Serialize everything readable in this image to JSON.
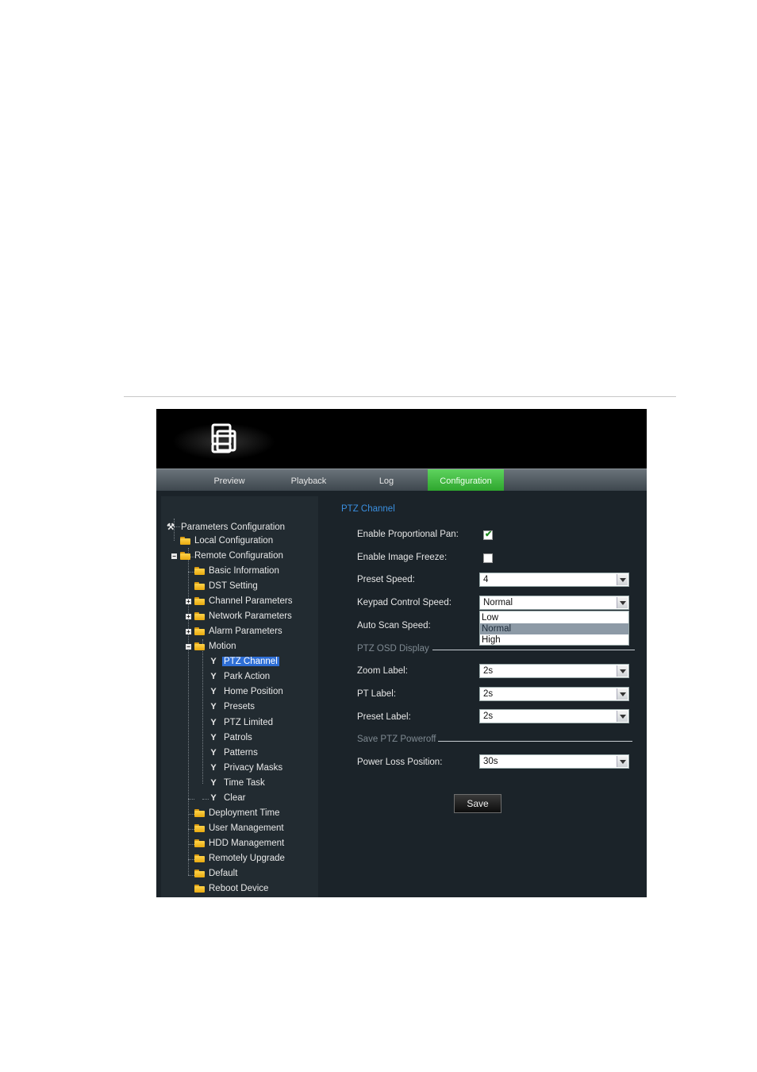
{
  "nav": {
    "tabs": [
      "Preview",
      "Playback",
      "Log",
      "Configuration"
    ],
    "active": "Configuration"
  },
  "tree": {
    "root": "Parameters Configuration",
    "items": [
      "Local Configuration",
      "Remote Configuration",
      "Basic Information",
      "DST Setting",
      "Channel Parameters",
      "Network Parameters",
      "Alarm Parameters",
      "Motion",
      "PTZ Channel",
      "Park Action",
      "Home Position",
      "Presets",
      "PTZ Limited",
      "Patrols",
      "Patterns",
      "Privacy Masks",
      "Time Task",
      "Clear",
      "Deployment Time",
      "User Management",
      "HDD Management",
      "Remotely Upgrade",
      "Default",
      "Reboot Device"
    ]
  },
  "panel": {
    "title": "PTZ Channel",
    "enable_proportional_pan": {
      "label": "Enable Proportional Pan:",
      "checked": true
    },
    "enable_image_freeze": {
      "label": "Enable Image Freeze:",
      "checked": false
    },
    "preset_speed": {
      "label": "Preset Speed:",
      "value": "4"
    },
    "keypad_control_speed": {
      "label": "Keypad Control Speed:",
      "value": "Normal",
      "options": [
        "Low",
        "Normal",
        "High"
      ],
      "highlighted": "Normal"
    },
    "auto_scan_speed": {
      "label": "Auto Scan Speed:"
    },
    "osd_section": "PTZ OSD Display",
    "zoom_label": {
      "label": "Zoom Label:",
      "value": "2s"
    },
    "pt_label": {
      "label": "PT Label:",
      "value": "2s"
    },
    "preset_label": {
      "label": "Preset Label:",
      "value": "2s"
    },
    "poweroff_section": "Save PTZ Poweroff",
    "power_loss_position": {
      "label": "Power Loss Position:",
      "value": "30s"
    },
    "save_label": "Save"
  },
  "colors": {
    "accent_tab": "#3fbf3f",
    "selection": "#2f6fd6",
    "title": "#3a8fe0"
  }
}
